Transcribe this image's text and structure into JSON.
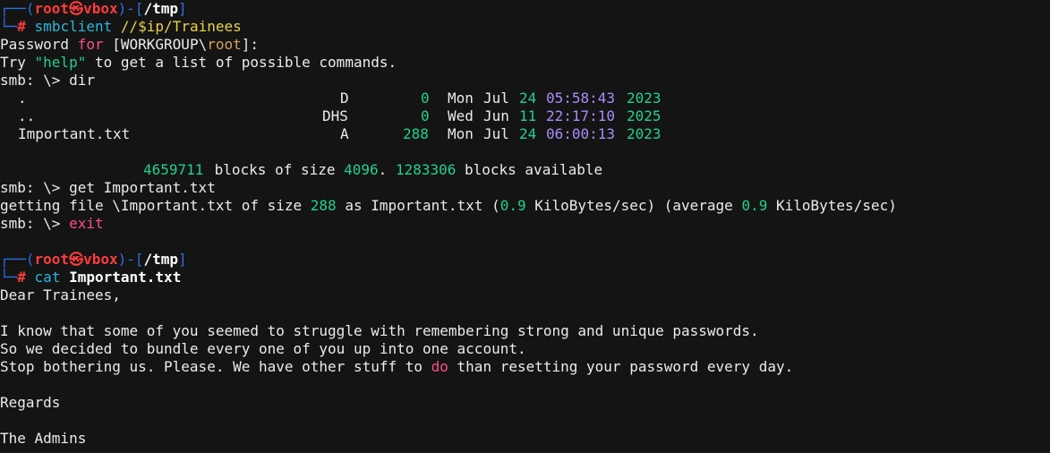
{
  "prompt": {
    "user": "root",
    "symbol": "㉿",
    "host": "vbox",
    "dir": "/tmp",
    "hash": "#"
  },
  "cmd1": {
    "name": "smbclient",
    "arg": "//$ip/Trainees"
  },
  "password_line": {
    "a": "Password ",
    "b": "for",
    "c": " [WORKGROUP\\",
    "d": "root",
    "e": "]:"
  },
  "help_line": {
    "a": "Try ",
    "b": "\"help\"",
    "c": " to get a list of possible commands."
  },
  "smb_prompt": "smb: \\> ",
  "cmd_dir": "dir",
  "listing": [
    {
      "name": ".",
      "attr": "D",
      "size": "0",
      "day": "Mon",
      "mon": "Jul",
      "date": "24",
      "time": "05:58:43",
      "year": "2023"
    },
    {
      "name": "..",
      "attr": "DHS",
      "size": "0",
      "day": "Wed",
      "mon": "Jun",
      "date": "11",
      "time": "22:17:10",
      "year": "2025"
    },
    {
      "name": "Important.txt",
      "attr": "A",
      "size": "288",
      "day": "Mon",
      "mon": "Jul",
      "date": "24",
      "time": "06:00:13",
      "year": "2023"
    }
  ],
  "blocks": {
    "n1": "4659711",
    "t1": " blocks of size ",
    "n2": "4096",
    "t2": ". ",
    "n3": "1283306",
    "t3": " blocks available"
  },
  "cmd_get": "get Important.txt",
  "getting": {
    "a": "getting file \\Important.txt of size ",
    "b": "288",
    "c": " as Important.txt (",
    "d": "0.9",
    "e": " KiloBytes/sec) (average ",
    "f": "0.9",
    "g": " KiloBytes/sec)"
  },
  "cmd_exit": "exit",
  "cmd2": {
    "name": "cat",
    "arg": "Important.txt"
  },
  "letter": {
    "greeting": "Dear Trainees,",
    "p1": "I know that some of you seemed to struggle with remembering strong and unique passwords.",
    "p2": "So we decided to bundle every one of you up into one account.",
    "p3a": "Stop bothering us. Please. We have other stuff to ",
    "p3b": "do",
    "p3c": " than resetting your password every day.",
    "regards": "Regards",
    "sign": "The Admins"
  },
  "colors": {
    "background": "#141414",
    "prompt_blue": "#2f6fe0",
    "prompt_red": "#ff3c3c",
    "green": "#23d18b",
    "purple": "#a98cf8",
    "yellow": "#e5d34a",
    "pink": "#ff4d8d"
  }
}
